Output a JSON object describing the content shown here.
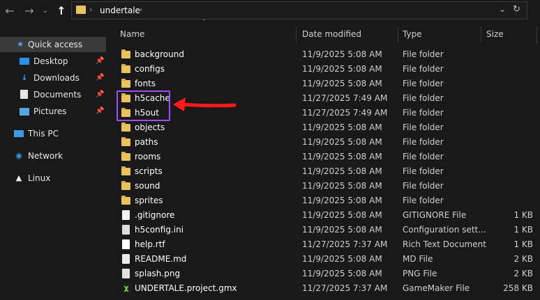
{
  "address_bar": {
    "path": "undertale"
  },
  "sidebar": {
    "items": [
      {
        "label": "Quick access",
        "icon": "star-icon",
        "selected": true
      },
      {
        "label": "Desktop",
        "icon": "desktop-icon",
        "pinned": true
      },
      {
        "label": "Downloads",
        "icon": "download-icon",
        "pinned": true
      },
      {
        "label": "Documents",
        "icon": "documents-icon",
        "pinned": true
      },
      {
        "label": "Pictures",
        "icon": "pictures-icon",
        "pinned": true
      },
      {
        "label": "This PC",
        "icon": "computer-icon"
      },
      {
        "label": "Network",
        "icon": "network-icon"
      },
      {
        "label": "Linux",
        "icon": "linux-icon"
      }
    ]
  },
  "columns": {
    "name": "Name",
    "date": "Date modified",
    "type": "Type",
    "size": "Size"
  },
  "files": [
    {
      "name": "background",
      "date": "11/9/2025 5:08 AM",
      "type": "File folder",
      "size": "",
      "icon": "folder-icon"
    },
    {
      "name": "configs",
      "date": "11/9/2025 5:08 AM",
      "type": "File folder",
      "size": "",
      "icon": "folder-icon"
    },
    {
      "name": "fonts",
      "date": "11/9/2025 5:08 AM",
      "type": "File folder",
      "size": "",
      "icon": "folder-icon"
    },
    {
      "name": "h5cache",
      "date": "11/27/2025 7:49 AM",
      "type": "File folder",
      "size": "",
      "icon": "folder-icon"
    },
    {
      "name": "h5out",
      "date": "11/27/2025 7:49 AM",
      "type": "File folder",
      "size": "",
      "icon": "folder-icon"
    },
    {
      "name": "objects",
      "date": "11/9/2025 5:08 AM",
      "type": "File folder",
      "size": "",
      "icon": "folder-icon"
    },
    {
      "name": "paths",
      "date": "11/9/2025 5:08 AM",
      "type": "File folder",
      "size": "",
      "icon": "folder-icon"
    },
    {
      "name": "rooms",
      "date": "11/9/2025 5:08 AM",
      "type": "File folder",
      "size": "",
      "icon": "folder-icon"
    },
    {
      "name": "scripts",
      "date": "11/9/2025 5:08 AM",
      "type": "File folder",
      "size": "",
      "icon": "folder-icon"
    },
    {
      "name": "sound",
      "date": "11/9/2025 5:08 AM",
      "type": "File folder",
      "size": "",
      "icon": "folder-icon"
    },
    {
      "name": "sprites",
      "date": "11/9/2025 5:08 AM",
      "type": "File folder",
      "size": "",
      "icon": "folder-icon"
    },
    {
      "name": ".gitignore",
      "date": "11/9/2025 5:08 AM",
      "type": "GITIGNORE File",
      "size": "1 KB",
      "icon": "file-icon"
    },
    {
      "name": "h5config.ini",
      "date": "11/9/2025 5:08 AM",
      "type": "Configuration sett...",
      "size": "1 KB",
      "icon": "config-file-icon"
    },
    {
      "name": "help.rtf",
      "date": "11/27/2025 7:37 AM",
      "type": "Rich Text Document",
      "size": "1 KB",
      "icon": "document-file-icon"
    },
    {
      "name": "README.md",
      "date": "11/9/2025 5:08 AM",
      "type": "MD File",
      "size": "2 KB",
      "icon": "file-icon"
    },
    {
      "name": "splash.png",
      "date": "11/9/2025 5:08 AM",
      "type": "PNG File",
      "size": "2 KB",
      "icon": "image-file-icon"
    },
    {
      "name": "UNDERTALE.project.gmx",
      "date": "11/27/2025 7:37 AM",
      "type": "GameMaker File",
      "size": "258 KB",
      "icon": "gamemaker-file-icon"
    }
  ],
  "colors": {
    "background": "#191919",
    "selection": "#3a3a3a",
    "folder": "#e8c25a",
    "highlight_box": "#a14cff",
    "arrow": "#ff1a1a"
  }
}
